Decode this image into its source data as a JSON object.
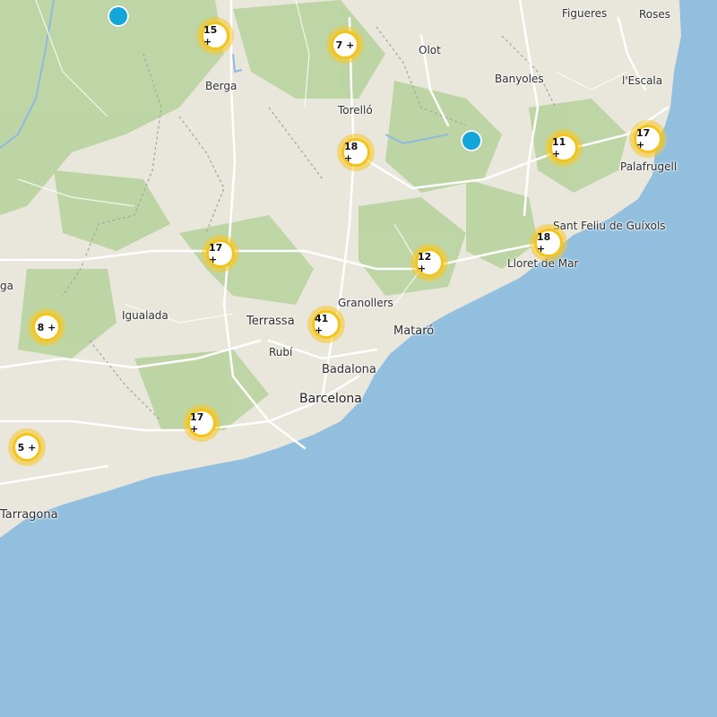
{
  "map": {
    "colors": {
      "sea": "#93bfdf",
      "land": "#e9e6dc",
      "forest": "#b9d39e",
      "road": "#ffffff",
      "border": "#a8a8a8",
      "river": "#8fb9e0",
      "cluster_ring": "#f6c419",
      "pin": "#12a7d8"
    },
    "cities": [
      {
        "id": "figueres",
        "name": "Figueres"
      },
      {
        "id": "roses",
        "name": "Roses"
      },
      {
        "id": "olot",
        "name": "Olot"
      },
      {
        "id": "banyoles",
        "name": "Banyoles"
      },
      {
        "id": "lescala",
        "name": "l'Escala"
      },
      {
        "id": "berga",
        "name": "Berga"
      },
      {
        "id": "torello",
        "name": "Torelló"
      },
      {
        "id": "palafrugell",
        "name": "Palafrugell"
      },
      {
        "id": "santfeliu",
        "name": "Sant Feliu de Guíxols"
      },
      {
        "id": "lloret",
        "name": "Lloret de Mar"
      },
      {
        "id": "granollers",
        "name": "Granollers"
      },
      {
        "id": "igualada",
        "name": "Igualada"
      },
      {
        "id": "terrassa",
        "name": "Terrassa"
      },
      {
        "id": "mataro",
        "name": "Mataró"
      },
      {
        "id": "rubi",
        "name": "Rubí"
      },
      {
        "id": "badalona",
        "name": "Badalona"
      },
      {
        "id": "barcelona",
        "name": "Barcelona"
      },
      {
        "id": "tarragona",
        "name": "Tarragona"
      },
      {
        "id": "partial_ga",
        "name": "ga"
      }
    ],
    "clusters": [
      {
        "id": "15",
        "label": "15 +"
      },
      {
        "id": "7",
        "label": "7 +"
      },
      {
        "id": "18a",
        "label": "18 +"
      },
      {
        "id": "11",
        "label": "11 +"
      },
      {
        "id": "17a",
        "label": "17 +"
      },
      {
        "id": "17b",
        "label": "17 +"
      },
      {
        "id": "12",
        "label": "12 +"
      },
      {
        "id": "18b",
        "label": "18 +"
      },
      {
        "id": "8",
        "label": "8 +"
      },
      {
        "id": "41",
        "label": "41 +"
      },
      {
        "id": "17c",
        "label": "17 +"
      },
      {
        "id": "5",
        "label": "5 +"
      }
    ],
    "pins": [
      {
        "id": "pin-north-west"
      },
      {
        "id": "pin-banyoles"
      }
    ]
  }
}
